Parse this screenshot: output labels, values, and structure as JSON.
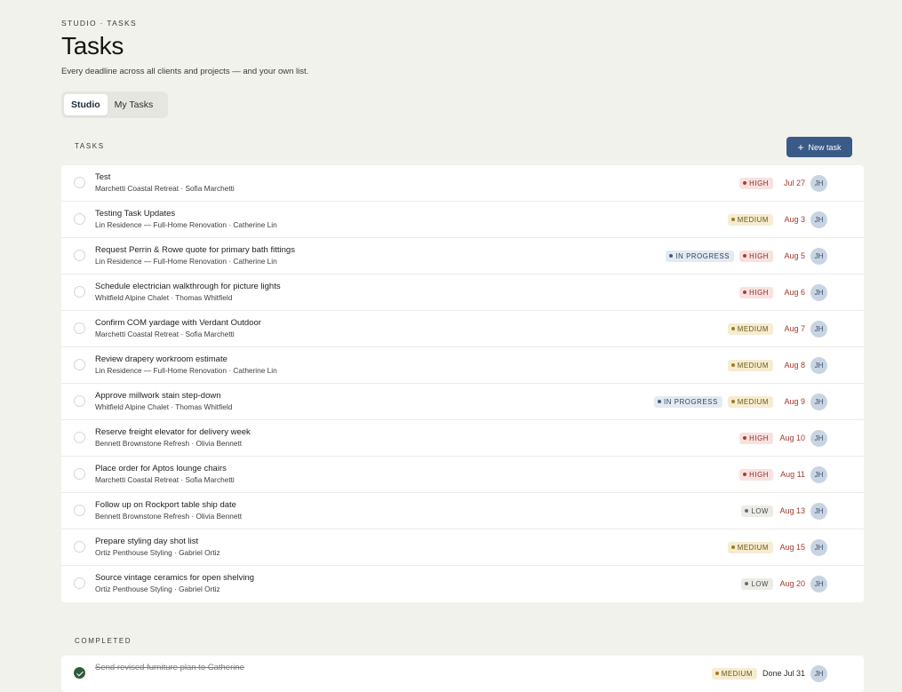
{
  "header": {
    "breadcrumb": "STUDIO · TASKS",
    "title": "Tasks",
    "subtitle": "Every deadline across all clients and projects — and your own list."
  },
  "tabs": [
    {
      "label": "Studio",
      "active": true
    },
    {
      "label": "My Tasks",
      "active": false
    }
  ],
  "tasks_section": {
    "label": "TASKS",
    "new_button": {
      "label": "New task",
      "icon": "plus-icon"
    }
  },
  "tasks": [
    {
      "name": "Test",
      "sub": "Marchetti Coastal Retreat · Sofia Marchetti",
      "status": "",
      "priority": "HIGH",
      "due": "Jul 27",
      "assignee": "JH"
    },
    {
      "name": "Testing Task Updates",
      "sub": "Lin Residence — Full-Home Renovation · Catherine Lin",
      "status": "",
      "priority": "MEDIUM",
      "due": "Aug 3",
      "assignee": "JH"
    },
    {
      "name": "Request Perrin & Rowe quote for primary bath fittings",
      "sub": "Lin Residence — Full-Home Renovation · Catherine Lin",
      "status": "IN PROGRESS",
      "priority": "HIGH",
      "due": "Aug 5",
      "assignee": "JH"
    },
    {
      "name": "Schedule electrician walkthrough for picture lights",
      "sub": "Whitfield Alpine Chalet · Thomas Whitfield",
      "status": "",
      "priority": "HIGH",
      "due": "Aug 6",
      "assignee": "JH"
    },
    {
      "name": "Confirm COM yardage with Verdant Outdoor",
      "sub": "Marchetti Coastal Retreat · Sofia Marchetti",
      "status": "",
      "priority": "MEDIUM",
      "due": "Aug 7",
      "assignee": "JH"
    },
    {
      "name": "Review drapery workroom estimate",
      "sub": "Lin Residence — Full-Home Renovation · Catherine Lin",
      "status": "",
      "priority": "MEDIUM",
      "due": "Aug 8",
      "assignee": "JH"
    },
    {
      "name": "Approve millwork stain step-down",
      "sub": "Whitfield Alpine Chalet · Thomas Whitfield",
      "status": "IN PROGRESS",
      "priority": "MEDIUM",
      "due": "Aug 9",
      "assignee": "JH"
    },
    {
      "name": "Reserve freight elevator for delivery week",
      "sub": "Bennett Brownstone Refresh · Olivia Bennett",
      "status": "",
      "priority": "HIGH",
      "due": "Aug 10",
      "assignee": "JH"
    },
    {
      "name": "Place order for Aptos lounge chairs",
      "sub": "Marchetti Coastal Retreat · Sofia Marchetti",
      "status": "",
      "priority": "HIGH",
      "due": "Aug 11",
      "assignee": "JH"
    },
    {
      "name": "Follow up on Rockport table ship date",
      "sub": "Bennett Brownstone Refresh · Olivia Bennett",
      "status": "",
      "priority": "LOW",
      "due": "Aug 13",
      "assignee": "JH"
    },
    {
      "name": "Prepare styling day shot list",
      "sub": "Ortiz Penthouse Styling · Gabriel Ortiz",
      "status": "",
      "priority": "MEDIUM",
      "due": "Aug 15",
      "assignee": "JH"
    },
    {
      "name": "Source vintage ceramics for open shelving",
      "sub": "Ortiz Penthouse Styling · Gabriel Ortiz",
      "status": "",
      "priority": "LOW",
      "due": "Aug 20",
      "assignee": "JH"
    }
  ],
  "completed_section": {
    "label": "COMPLETED"
  },
  "completed": [
    {
      "name": "Send revised furniture plan to Catherine",
      "sub": "",
      "status": "",
      "priority": "MEDIUM",
      "due": "Done Jul 31",
      "assignee": "JH"
    }
  ],
  "colors": {
    "accent": "#3a5a88",
    "background": "#f2f2ed",
    "high": "#b8372c",
    "medium": "#a07c1c",
    "low": "#6e6e69",
    "in_progress": "#3f5f86",
    "done": "#2e5b3e"
  }
}
